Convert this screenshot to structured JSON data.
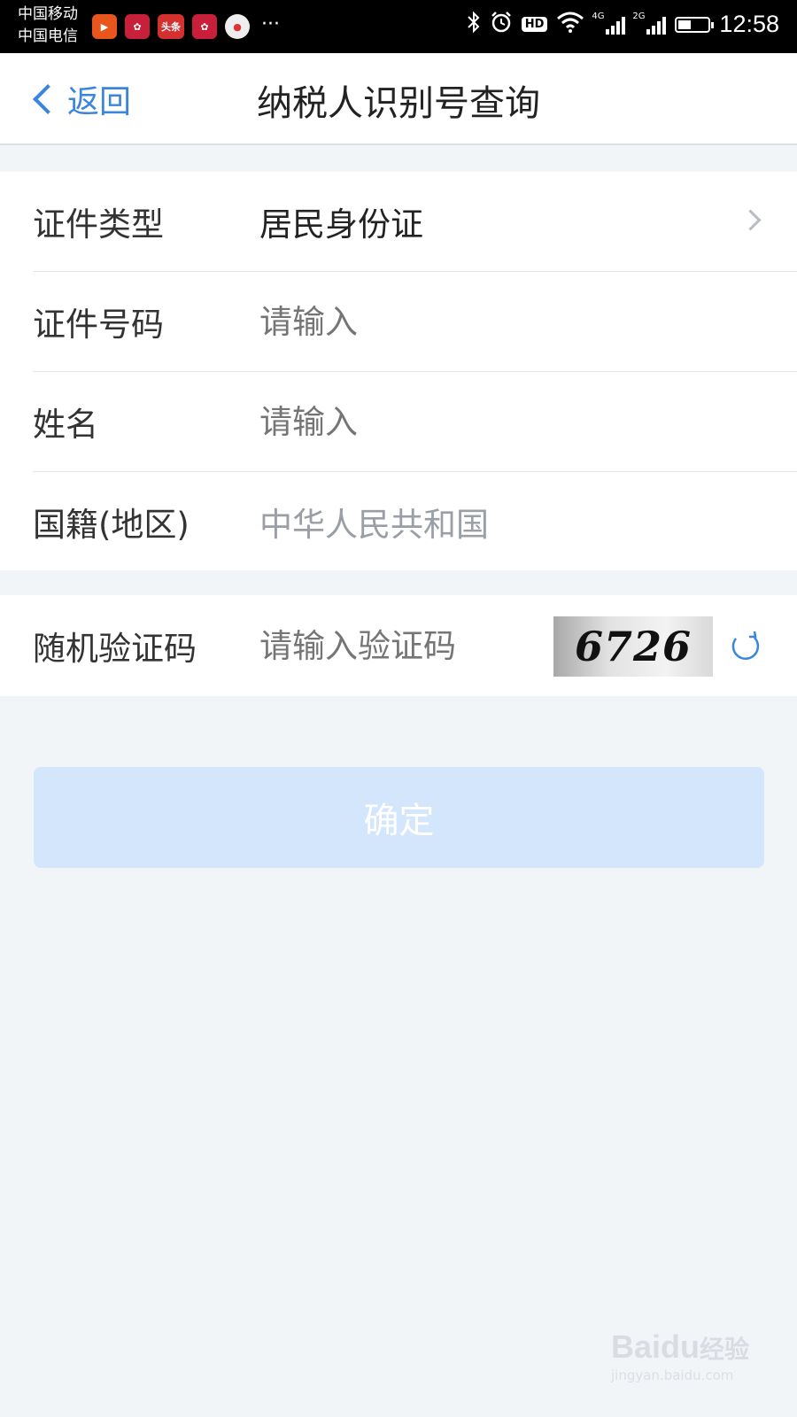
{
  "status_bar": {
    "carrier_1": "中国移动",
    "carrier_2": "中国电信",
    "app_icons": [
      "video-icon",
      "huawei-icon",
      "toutiao-icon",
      "huawei-icon",
      "map-icon"
    ],
    "toutiao_label": "头条",
    "more": "···",
    "hd": "HD",
    "signal_1_tag": "4G",
    "signal_2_tag": "2G",
    "battery_level": 0.45,
    "time": "12:58"
  },
  "nav": {
    "back_label": "返回",
    "title": "纳税人识别号查询"
  },
  "form": {
    "id_type": {
      "label": "证件类型",
      "value": "居民身份证"
    },
    "id_number": {
      "label": "证件号码",
      "placeholder": "请输入"
    },
    "name": {
      "label": "姓名",
      "placeholder": "请输入"
    },
    "nationality": {
      "label": "国籍(地区)",
      "value": "中华人民共和国"
    }
  },
  "captcha": {
    "label": "随机验证码",
    "placeholder": "请输入验证码",
    "code": "6726"
  },
  "confirm_label": "确定",
  "watermark": {
    "brand": "Baidu",
    "brand_cn": "经验",
    "url": "jingyan.baidu.com"
  },
  "colors": {
    "accent": "#3a86dd",
    "page_bg": "#f2f5f8",
    "button_disabled": "#d3e6fb",
    "placeholder": "#b8bcc2"
  }
}
